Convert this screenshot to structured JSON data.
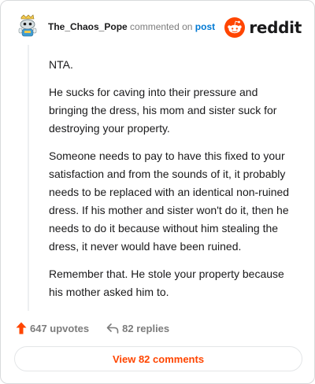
{
  "comment": {
    "username": "The_Chaos_Pope",
    "commented_on": "commented on",
    "post_link": "post",
    "paragraphs": [
      "NTA.",
      "He sucks for caving into their pressure and bringing the dress, his mom and sister suck for destroying your property.",
      "Someone needs to pay to have this fixed to your satisfaction and from the sounds of it, it probably needs to be replaced with an identical non-ruined dress. If his mother and sister won't do it, then he needs to do it because without him stealing the dress, it never would have been ruined.",
      "Remember that. He stole your property because his mother asked him to."
    ],
    "upvotes": "647 upvotes",
    "replies": "82 replies",
    "view_comments": "View 82 comments"
  },
  "brand": {
    "logo_text": "reddit",
    "logo_icon": "reddit-snoo-icon",
    "accent": "#ff4500",
    "link_color": "#0079d3"
  },
  "icons": {
    "upvote": "upvote-arrow-icon",
    "reply": "reply-arrow-icon",
    "avatar": "snoo-avatar"
  }
}
